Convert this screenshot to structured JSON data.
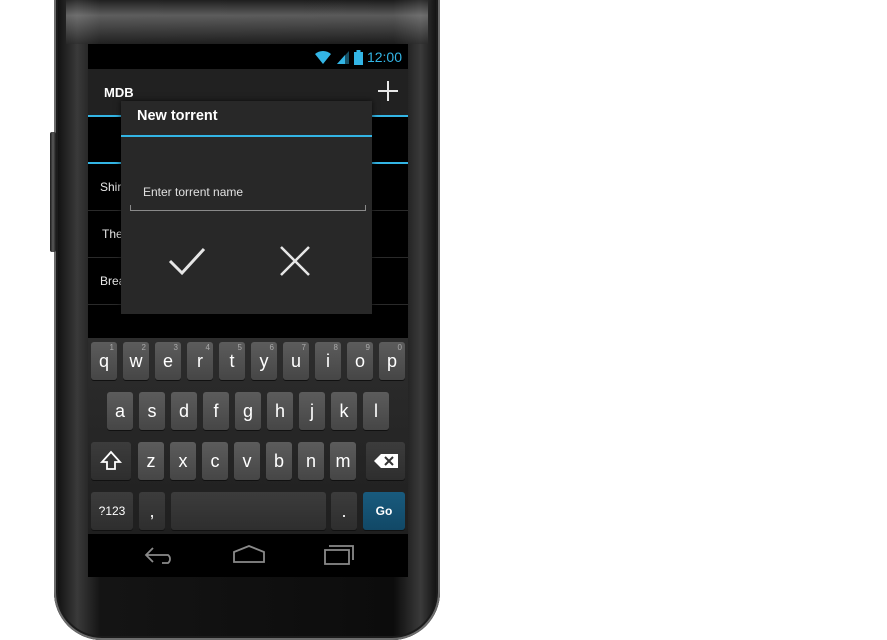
{
  "status": {
    "time": "12:00"
  },
  "app": {
    "title": "MDB"
  },
  "list": {
    "items": [
      "Shir",
      "The",
      "Brea"
    ]
  },
  "dialog": {
    "title": "New torrent",
    "input": {
      "placeholder": "Enter torrent name",
      "value": ""
    }
  },
  "keyboard": {
    "row1": [
      {
        "label": "q",
        "hint": "1"
      },
      {
        "label": "w",
        "hint": "2"
      },
      {
        "label": "e",
        "hint": "3"
      },
      {
        "label": "r",
        "hint": "4"
      },
      {
        "label": "t",
        "hint": "5"
      },
      {
        "label": "y",
        "hint": "6"
      },
      {
        "label": "u",
        "hint": "7"
      },
      {
        "label": "i",
        "hint": "8"
      },
      {
        "label": "o",
        "hint": "9"
      },
      {
        "label": "p",
        "hint": "0"
      }
    ],
    "row2": [
      "a",
      "s",
      "d",
      "f",
      "g",
      "h",
      "j",
      "k",
      "l"
    ],
    "row3": [
      "z",
      "x",
      "c",
      "v",
      "b",
      "n",
      "m"
    ],
    "symbols": "?123",
    "comma": ",",
    "period": ".",
    "go": "Go"
  },
  "colors": {
    "accent": "#33b5e5",
    "go_key": "#195b7e"
  },
  "icons": {
    "wifi": "wifi-icon",
    "signal": "signal-icon",
    "battery": "battery-icon",
    "add": "plus-icon",
    "confirm": "check-icon",
    "cancel": "close-icon",
    "shift": "shift-icon",
    "backspace": "backspace-icon",
    "back": "back-icon",
    "home": "home-icon",
    "recents": "recents-icon"
  }
}
